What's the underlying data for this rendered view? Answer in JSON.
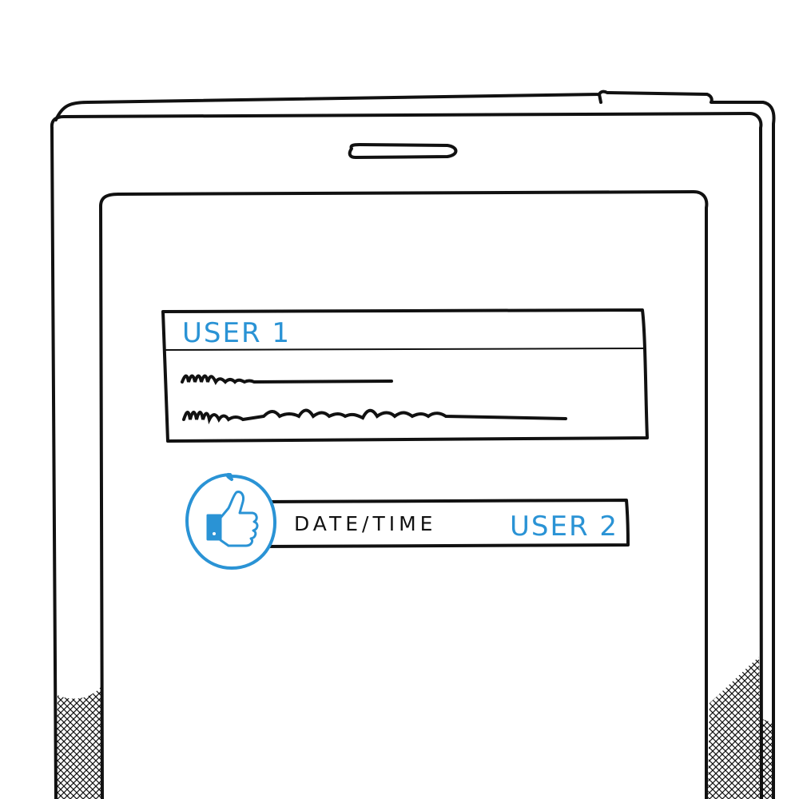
{
  "accent_color": "#2a93d5",
  "ink_color": "#111111",
  "post": {
    "author": "USER 1"
  },
  "like_row": {
    "icon": "thumbs-up-icon",
    "datetime": "DATE/TIME",
    "user": "USER 2"
  }
}
